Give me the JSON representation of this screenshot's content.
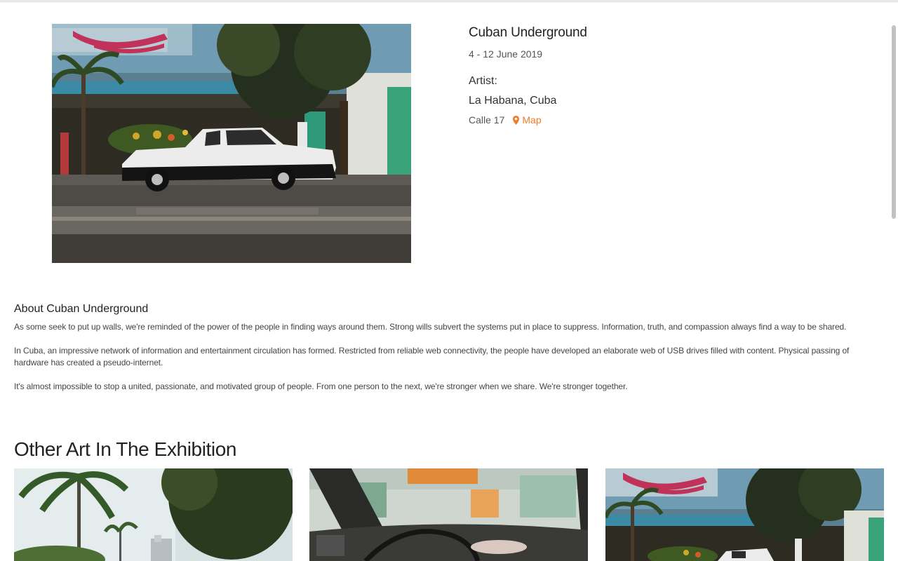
{
  "exhibition": {
    "title": "Cuban Underground",
    "dates": "4 - 12 June 2019",
    "artist_label": "Artist:",
    "location": "La Habana, Cuba",
    "address": "Calle 17",
    "map_label": "Map",
    "hero_image": "street scene with white vintage car"
  },
  "about": {
    "heading": "About Cuban Underground",
    "paragraphs": [
      "As some seek to put up walls, we're reminded of the power of the people in finding ways around them. Strong wills subvert the systems put in place to suppress. Information, truth, and compassion always find a way to be shared.",
      "In Cuba, an impressive network of information and entertainment circulation has formed. Restricted from reliable web connectivity, the people have developed an elaborate web of USB drives filled with content. Physical passing of hardware has created a pseudo-internet.",
      "It's almost impossible to stop a united, passionate, and motivated group of people. From one person to the next, we're stronger when we share. We're stronger together."
    ]
  },
  "other_art": {
    "heading": "Other Art In The Exhibition",
    "items": [
      {
        "image": "palm trees and buildings"
      },
      {
        "image": "car interior with steering wheel"
      },
      {
        "image": "street scene with white vintage car"
      }
    ]
  },
  "colors": {
    "accent": "#f07b2b",
    "text": "#222222",
    "muted": "#555555"
  },
  "icons": {
    "map": "map-pin-icon"
  }
}
